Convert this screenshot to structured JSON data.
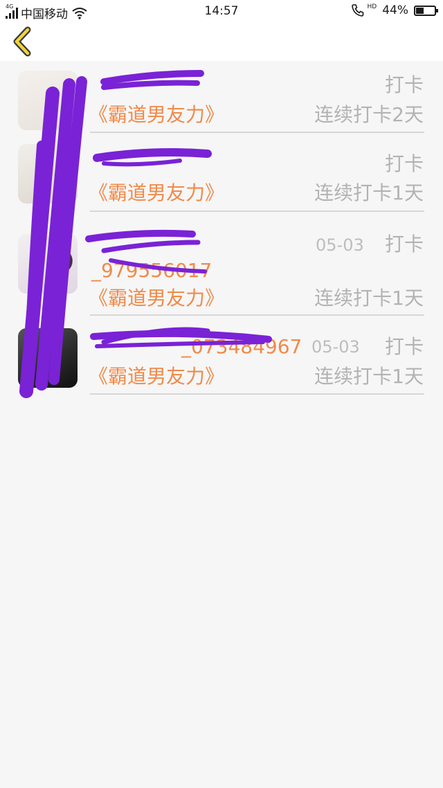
{
  "status_bar": {
    "network": "4G",
    "carrier": "中国移动",
    "time": "14:57",
    "hd": "HD",
    "battery": "44%",
    "battery_level": 0.44
  },
  "nav": {
    "back_icon": "chevron-left-icon",
    "accent": "#f2b705"
  },
  "colors": {
    "highlight": "#f08a4a",
    "muted": "#b3b3b3",
    "redaction": "#7a22d6"
  },
  "entries": [
    {
      "name": "",
      "date": "",
      "action": "打卡",
      "book": "《霸道男友力》",
      "streak": "连续打卡2天"
    },
    {
      "name": "",
      "date": "",
      "action": "打卡",
      "book": "《霸道男友力》",
      "streak": "连续打卡1天"
    },
    {
      "name": "_979556017",
      "date": "05-03",
      "action": "打卡",
      "book": "《霸道男友力》",
      "streak": "连续打卡1天"
    },
    {
      "name": "_073484967",
      "date": "05-03",
      "action": "打卡",
      "book": "《霸道男友力》",
      "streak": "连续打卡1天"
    }
  ]
}
